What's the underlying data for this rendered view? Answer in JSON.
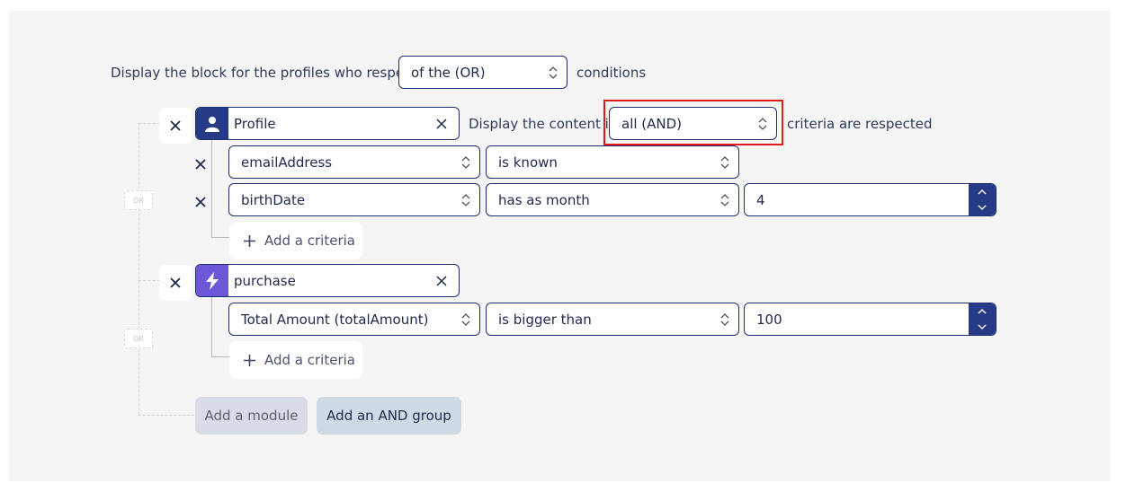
{
  "colors": {
    "accent": "#263a86",
    "border": "#1f2f6b",
    "event_module": "#6e56d8",
    "highlight": "#e5181c"
  },
  "header": {
    "prefix": "Display the block for the profiles who respect",
    "condition_select": "of the (OR)",
    "suffix": "conditions"
  },
  "groups": [
    {
      "module": {
        "icon": "user-icon",
        "label": "Profile"
      },
      "content_prefix": "Display the content if",
      "match_select": "all (AND)",
      "content_suffix": "criteria are respected",
      "criteria": [
        {
          "field": "emailAddress",
          "operator": "is known",
          "value": ""
        },
        {
          "field": "birthDate",
          "operator": "has as month",
          "value": "4"
        }
      ],
      "add_criteria_label": "Add a criteria"
    },
    {
      "module": {
        "icon": "lightning-icon",
        "label": "purchase"
      },
      "criteria": [
        {
          "field": "Total Amount (totalAmount)",
          "operator": "is bigger than",
          "value": "100"
        }
      ],
      "add_criteria_label": "Add a criteria"
    }
  ],
  "or_label": "OR",
  "footer": {
    "add_module_label": "Add a module",
    "add_and_group_label": "Add an AND group"
  }
}
